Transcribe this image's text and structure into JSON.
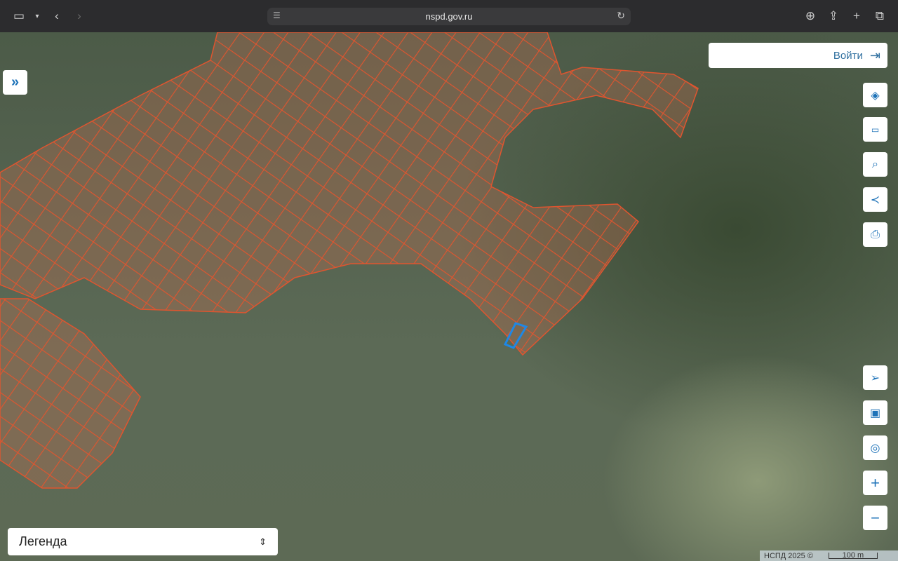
{
  "browser": {
    "url": "nspd.gov.ru"
  },
  "map": {
    "login_label": "Войти",
    "legend_label": "Легенда",
    "attribution": "НСПД 2025 ©",
    "scale_label": "100 m",
    "tools": [
      "layers",
      "ruler",
      "select-area",
      "share",
      "print",
      "locate",
      "minimap",
      "search-location",
      "zoom-in",
      "zoom-out"
    ],
    "colors": {
      "parcel": "#e0552f",
      "selected": "#1e88e5",
      "accent": "#1d72b8"
    }
  }
}
